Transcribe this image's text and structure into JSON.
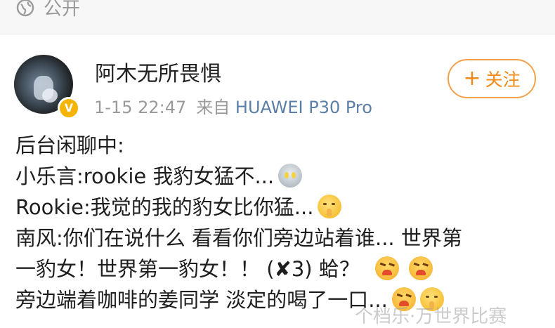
{
  "post": {
    "visibility": "公开",
    "author": "阿木无所畏惧",
    "follow_label": "关注",
    "time": "1-15 22:47",
    "source_prefix": "来自",
    "device": "HUAWEI P30 Pro",
    "lines": [
      "后台闲聊中:",
      "小乐言:rookie  我豹女猛不...",
      "Rookie:我觉的我的豹女比你猛...",
      "南风:你们在说什么  看看你们旁边站着谁... 世界第",
      "一豹女！世界第一豹女！！ (✘3) 蛤？",
      "旁边端着咖啡的姜同学  淡定的喝了一口..."
    ]
  },
  "icons": {
    "visibility": "globe-icon",
    "verified": "verified-v-badge-icon",
    "emoji_ultraman": "ultraman-emoji-icon",
    "emoji_shh": "shh-emoji-icon",
    "emoji_angry": "angry-emoji-icon"
  },
  "watermark": "个档乐·万世界比赛",
  "colors": {
    "accent_orange": "#f08a18",
    "device_link": "#5b7fa6",
    "meta_gray": "#9a9a9a",
    "verified_badge": "#f5b400"
  }
}
